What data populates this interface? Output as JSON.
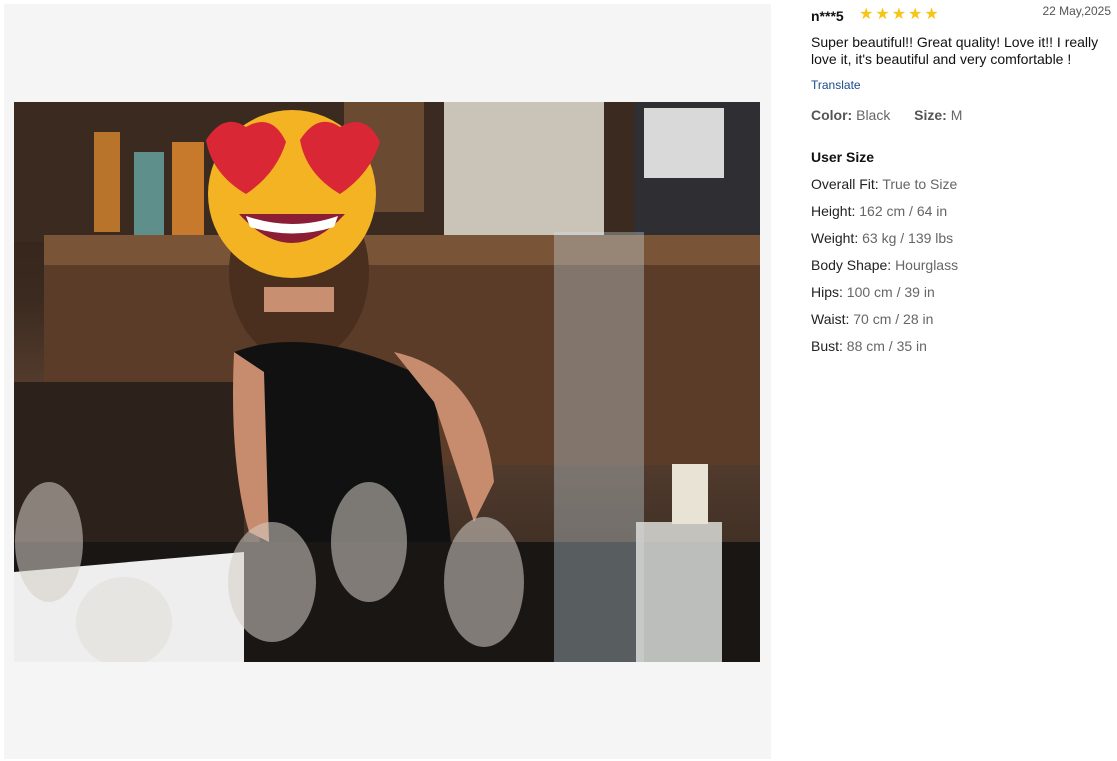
{
  "review": {
    "reviewer": "n***5",
    "rating": 5,
    "stars": "★★★★★",
    "date": "22 May,2025",
    "text": "Super beautiful!! Great quality! Love it!! I really love it, it's beautiful and very comfortable !",
    "translate_label": "Translate",
    "color_label": "Color:",
    "color_value": "Black",
    "size_label": "Size:",
    "size_value": "M"
  },
  "user_size": {
    "title": "User Size",
    "items": [
      {
        "label": "Overall Fit:",
        "value": "True to Size"
      },
      {
        "label": "Height:",
        "value": "162 cm / 64 in"
      },
      {
        "label": "Weight:",
        "value": "63 kg / 139 lbs"
      },
      {
        "label": "Body Shape:",
        "value": "Hourglass"
      },
      {
        "label": "Hips:",
        "value": "100 cm / 39 in"
      },
      {
        "label": "Waist:",
        "value": "70 cm / 28 in"
      },
      {
        "label": "Bust:",
        "value": "88 cm / 35 in"
      }
    ]
  },
  "colors": {
    "star": "#f5c518",
    "link": "#1a4a8e",
    "panel_bg": "#f5f5f5"
  }
}
